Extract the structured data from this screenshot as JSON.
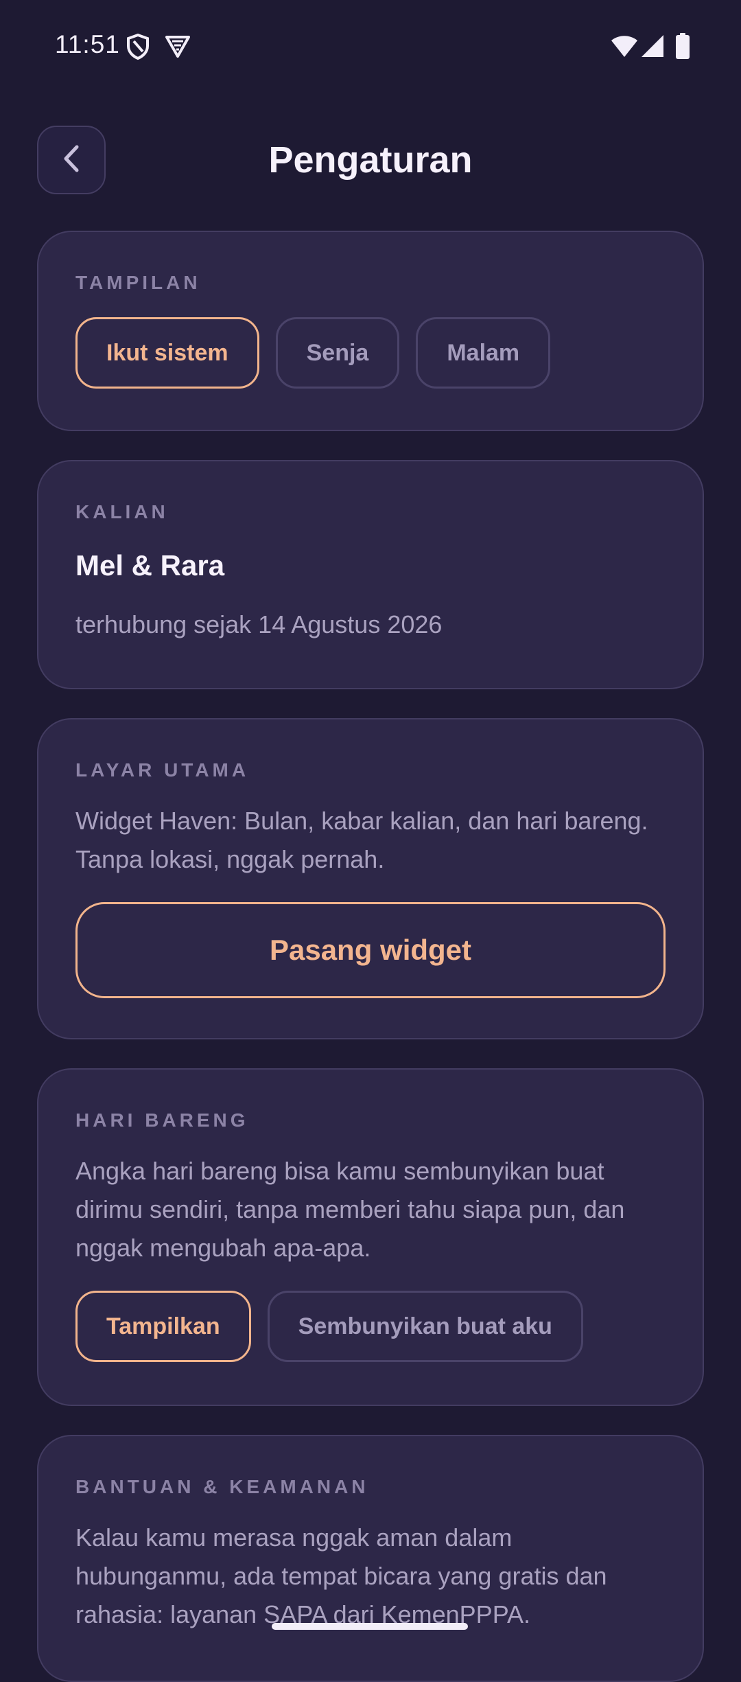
{
  "status_bar": {
    "time": "11:51",
    "icons": [
      "shield-icon",
      "vpn-icon",
      "wifi-icon",
      "cellular-signal-icon",
      "battery-icon"
    ]
  },
  "header": {
    "back_icon": "chevron-left-icon",
    "title": "Pengaturan"
  },
  "appearance": {
    "label": "TAMPILAN",
    "options": [
      {
        "label": "Ikut sistem",
        "selected": true
      },
      {
        "label": "Senja",
        "selected": false
      },
      {
        "label": "Malam",
        "selected": false
      }
    ]
  },
  "couple": {
    "label": "KALIAN",
    "names": "Mel & Rara",
    "connected_since": "terhubung sejak 14 Agustus 2026"
  },
  "home_screen": {
    "label": "LAYAR UTAMA",
    "description": "Widget Haven: Bulan, kabar kalian, dan hari bareng. Tanpa lokasi, nggak pernah.",
    "button": "Pasang widget"
  },
  "days_together": {
    "label": "HARI BARENG",
    "description": "Angka hari bareng bisa kamu sembunyikan buat dirimu sendiri, tanpa memberi tahu siapa pun, dan nggak mengubah apa-apa.",
    "options": [
      {
        "label": "Tampilkan",
        "selected": true
      },
      {
        "label": "Sembunyikan buat aku",
        "selected": false
      }
    ]
  },
  "help_safety": {
    "label": "BANTUAN & KEAMANAN",
    "description": "Kalau kamu merasa nggak aman dalam hubunganmu, ada tempat bicara yang gratis dan rahasia: layanan SAPA dari KemenPPPA."
  },
  "colors": {
    "background": "#1e1a33",
    "card": "#2d2748",
    "accent": "#f3b58f",
    "muted_text": "#8c83a6"
  }
}
